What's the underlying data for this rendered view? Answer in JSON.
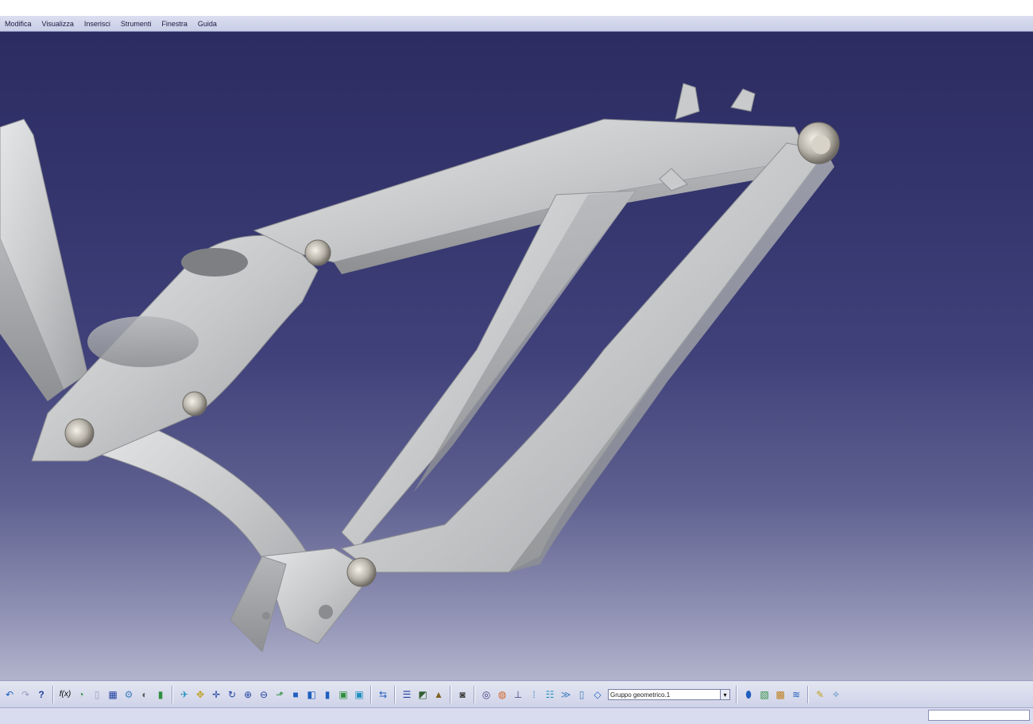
{
  "menubar": {
    "items": [
      "Modifica",
      "Visualizza",
      "Inserisci",
      "Strumenti",
      "Finestra",
      "Guida"
    ]
  },
  "viewport": {
    "background_top": "#2c2c62",
    "background_bottom": "#b2b3cc",
    "part_color": "#c8cacc"
  },
  "toolbar": {
    "geometric_set_value": "Gruppo geometrico.1",
    "icons": [
      "undo-icon",
      "redo-icon",
      "whats-this-icon",
      "formula-icon",
      "comment-icon",
      "knowledge-icon",
      "parameter-table-icon",
      "tree-icon",
      "analysis-icon",
      "hide-icon",
      "fly-mode-icon",
      "fit-all-icon",
      "pan-icon",
      "rotate-icon",
      "zoom-in-icon",
      "zoom-out-icon",
      "normal-view-icon",
      "views-icon",
      "render-style-icon",
      "hide-show-icon",
      "swap-visible-icon",
      "create-view-icon",
      "measure-icon",
      "catalog-icon",
      "material-icon",
      "capture-icon",
      "sketcher-icon",
      "point-icon",
      "line-icon",
      "plane-icon",
      "axis-icon",
      "work-object-icon",
      "geometric-set-icon",
      "surface-icon",
      "multi-section-icon",
      "sweep-icon",
      "thickness-icon",
      "knowledge-advisor-icon",
      "settings-icon"
    ]
  },
  "statusbar": {
    "command_placeholder": ""
  }
}
